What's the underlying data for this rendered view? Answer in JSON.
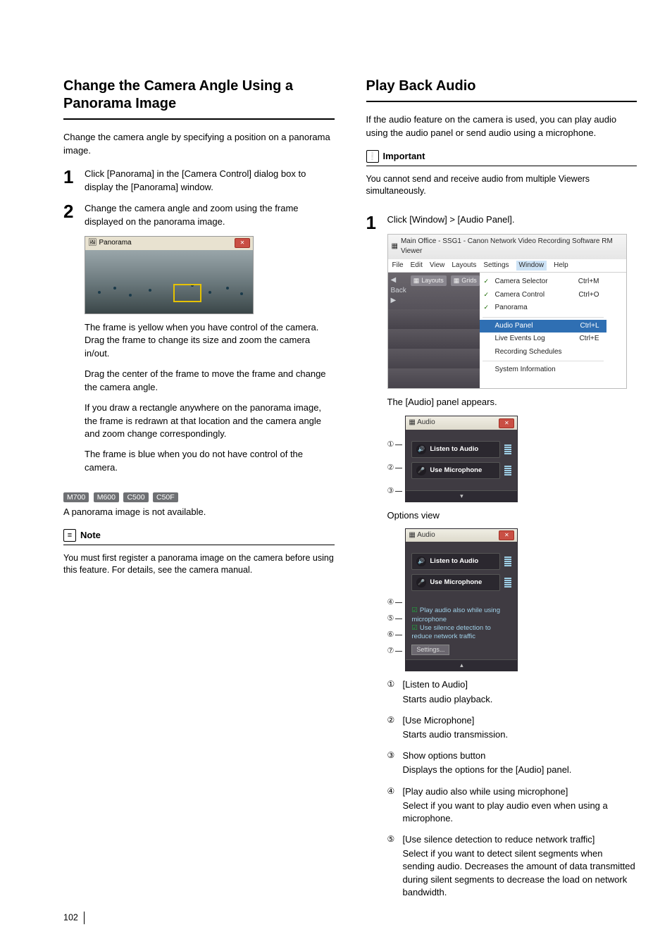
{
  "pageNumber": "102",
  "left": {
    "heading": "Change the Camera Angle Using a Panorama Image",
    "intro": "Change the camera angle by specifying a position on a panorama image.",
    "step1": "Click [Panorama] in the [Camera Control] dialog box to display the [Panorama] window.",
    "step2": "Change the camera angle and zoom using the frame displayed on the panorama image.",
    "panorama_title": "Panorama",
    "after_fig_p1": "The frame is yellow when you have control of the camera. Drag the frame to change its size and zoom the camera in/out.",
    "after_fig_p2": "Drag the center of the frame to move the frame and change the camera angle.",
    "after_fig_p3": "If you draw a rectangle anywhere on the panorama image, the frame is redrawn at that location and the camera angle and zoom change correspondingly.",
    "after_fig_p4": "The frame is blue when you do not have control of the camera.",
    "badges": {
      "b1": "M700",
      "b2": "M600",
      "b3": "C500",
      "b4": "C50F"
    },
    "pano_na": "A panorama image is not available.",
    "note_title": "Note",
    "note_body": "You must first register a panorama image on the camera before using this feature. For details, see the camera manual."
  },
  "right": {
    "heading": "Play Back Audio",
    "intro": "If the audio feature on the camera is used, you can play audio using the audio panel or send audio using a microphone.",
    "imp_title": "Important",
    "imp_body": "You cannot send and receive audio from multiple Viewers simultaneously.",
    "step1": "Click [Window] > [Audio Panel].",
    "win_title": "Main Office - SSG1 - Canon Network Video Recording Software RM Viewer",
    "menus": {
      "file": "File",
      "edit": "Edit",
      "view": "View",
      "layouts": "Layouts",
      "settings": "Settings",
      "window": "Window",
      "help": "Help"
    },
    "toolbar": {
      "back": "Back",
      "layouts": "Layouts",
      "grids": "Grids"
    },
    "dropdown": {
      "camera_selector": "Camera Selector",
      "cs_sc": "Ctrl+M",
      "camera_control": "Camera Control",
      "cc_sc": "Ctrl+O",
      "panorama": "Panorama",
      "audio_panel": "Audio Panel",
      "ap_sc": "Ctrl+L",
      "live_events": "Live Events Log",
      "le_sc": "Ctrl+E",
      "rec_sched": "Recording Schedules",
      "sys_info": "System Information"
    },
    "after_menu": "The [Audio] panel appears.",
    "audio_title": "Audio",
    "btn_listen": "Listen to Audio",
    "btn_mic": "Use Microphone",
    "options_view": "Options view",
    "opt1": "Play audio also while using microphone",
    "opt2": "Use silence detection to reduce network traffic",
    "settings_btn": "Settings...",
    "markers": {
      "m1": "①",
      "m2": "②",
      "m3": "③",
      "m4": "④",
      "m5": "⑤",
      "m6": "⑥",
      "m7": "⑦"
    },
    "items": {
      "i1_lbl": "[Listen to Audio]",
      "i1_desc": "Starts audio playback.",
      "i2_lbl": "[Use Microphone]",
      "i2_desc": "Starts audio transmission.",
      "i3_lbl": "Show options button",
      "i3_desc": "Displays the options for the [Audio] panel.",
      "i4_lbl": "[Play audio also while using microphone]",
      "i4_desc": "Select if you want to play audio even when using a microphone.",
      "i5_lbl": "[Use silence detection to reduce network traffic]",
      "i5_desc": "Select if you want to detect silent segments when sending audio. Decreases the amount of data transmitted during silent segments to decrease the load on network bandwidth."
    }
  }
}
